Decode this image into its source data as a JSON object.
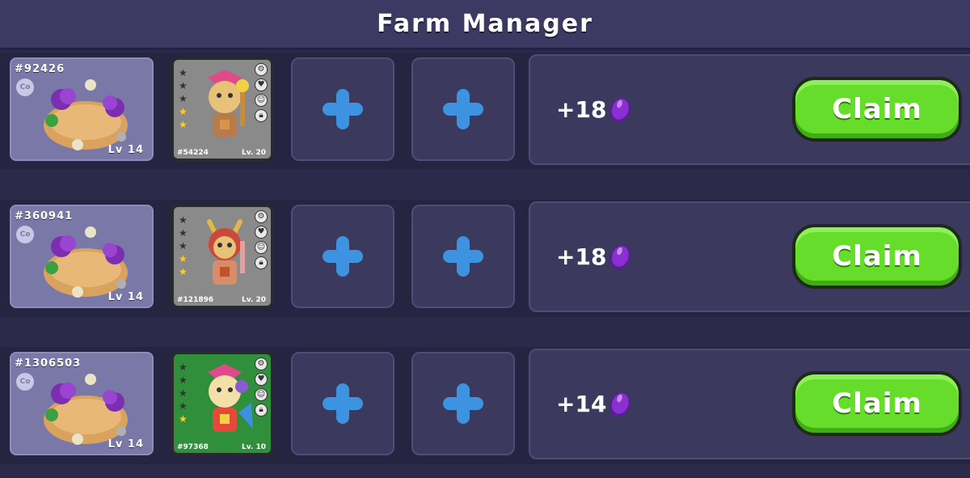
{
  "header": {
    "title": "Farm Manager"
  },
  "rows": [
    {
      "land": {
        "id": "#92426",
        "badge": "Co",
        "level": "Lv 14"
      },
      "pet": {
        "id": "#54224",
        "level": "Lv. 20",
        "stars_filled": 2,
        "stars_total": 5,
        "background": "gray"
      },
      "reward": {
        "amount": "+18"
      },
      "claim_label": "Claim"
    },
    {
      "land": {
        "id": "#360941",
        "badge": "Co",
        "level": "Lv 14"
      },
      "pet": {
        "id": "#121896",
        "level": "Lv. 20",
        "stars_filled": 2,
        "stars_total": 5,
        "background": "gray"
      },
      "reward": {
        "amount": "+18"
      },
      "claim_label": "Claim"
    },
    {
      "land": {
        "id": "#1306503",
        "badge": "Co",
        "level": "Lv 14"
      },
      "pet": {
        "id": "#97368",
        "level": "Lv. 10",
        "stars_filled": 1,
        "stars_total": 5,
        "background": "green"
      },
      "reward": {
        "amount": "+14"
      },
      "claim_label": "Claim"
    }
  ],
  "icons": {
    "empty_slot": "plus-icon",
    "reward_currency": "purple-gem-icon",
    "pet_side": [
      "settings-icon",
      "heart-icon",
      "mood-icon",
      "lock-icon"
    ]
  },
  "colors": {
    "background": "#2b2a4a",
    "claim_button": "#66dd2a",
    "plus": "#3d93e0",
    "gem": "#8a2fd0"
  }
}
